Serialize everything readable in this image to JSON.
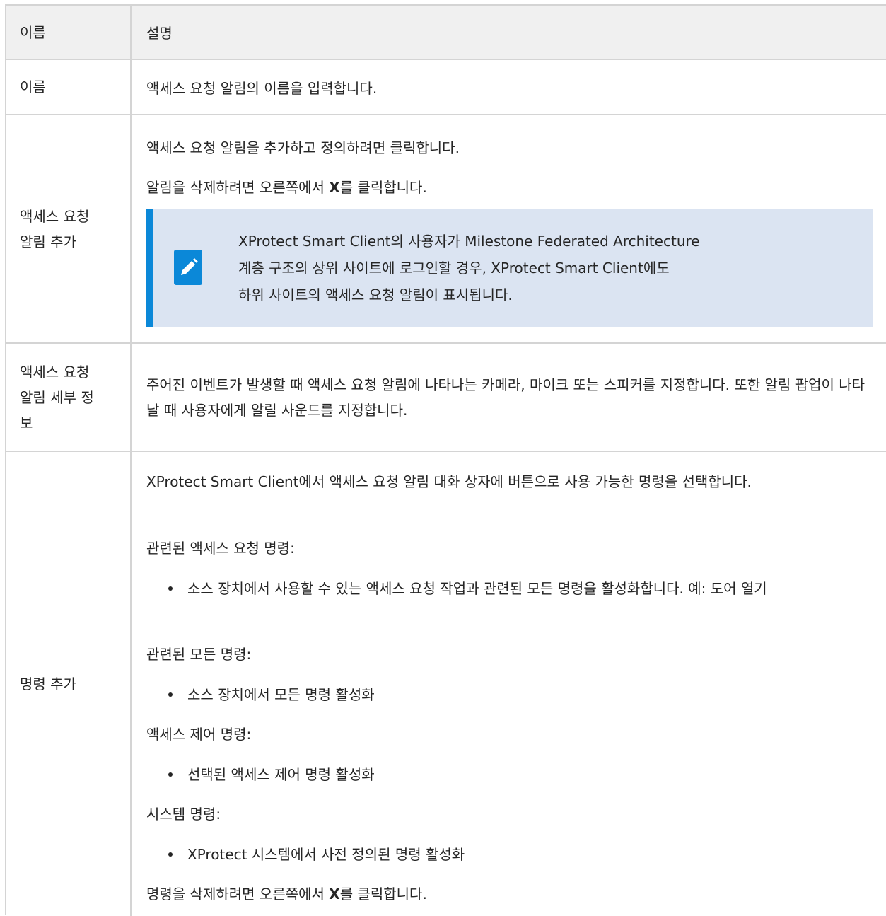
{
  "header": {
    "name": "이름",
    "desc": "설명"
  },
  "rows": {
    "name_row": {
      "name": "이름",
      "desc": "액세스 요청 알림의 이름을 입력합니다."
    },
    "add_row": {
      "name": "액세스 요청 알림 추가",
      "p1": "액세스 요청 알림을 추가하고 정의하려면 클릭합니다.",
      "p2_a": "알림을 삭제하려면 오른쪽에서 ",
      "p2_x": "X",
      "p2_b": "를 클릭합니다.",
      "note": {
        "icon": "pencil-icon",
        "line1": "XProtect Smart Client의 사용자가 Milestone Federated Architecture",
        "line2": "계층 구조의 상위 사이트에 로그인할 경우, XProtect Smart Client에도",
        "line3": "하위 사이트의 액세스 요청 알림이 표시됩니다."
      }
    },
    "details_row": {
      "name": "액세스 요청 알림 세부 정보",
      "desc": "주어진 이벤트가 발생할 때 액세스 요청 알림에 나타나는 카메라, 마이크 또는 스피커를 지정합니다. 또한 알림 팝업이 나타날 때 사용자에게 알릴 사운드를 지정합니다."
    },
    "commands_row": {
      "name": "명령 추가",
      "intro": "XProtect Smart Client에서 액세스 요청 알림 대화 상자에 버튼으로 사용 가능한 명령을 선택합니다.",
      "g1_title": "관련된 액세스 요청 명령:",
      "g1_item": "소스 장치에서 사용할 수 있는 액세스 요청 작업과 관련된 모든 명령을 활성화합니다. 예: 도어 열기",
      "g2_title": "관련된 모든 명령:",
      "g2_item": "소스 장치에서 모든 명령 활성화",
      "g3_title": "액세스 제어 명령:",
      "g3_item": "선택된 액세스 제어 명령 활성화",
      "g4_title": "시스템 명령:",
      "g4_item": "XProtect 시스템에서 사전 정의된 명령 활성화",
      "outro_a": "명령을 삭제하려면 오른쪽에서 ",
      "outro_x": "X",
      "outro_b": "를 클릭합니다."
    }
  },
  "colors": {
    "header_bg": "#f0f0f0",
    "border": "#d4d4d4",
    "note_bg": "#dbe4f2",
    "note_accent": "#0b88d8",
    "text": "#252525"
  }
}
